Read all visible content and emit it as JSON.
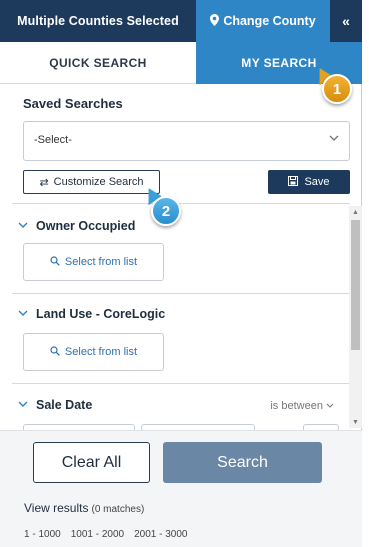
{
  "header": {
    "multiple_counties": "Multiple Counties Selected",
    "change_county": "Change County",
    "collapse": "«"
  },
  "tabs": [
    {
      "label": "QUICK SEARCH",
      "active": false
    },
    {
      "label": "MY SEARCH",
      "active": true
    }
  ],
  "callouts": [
    "1",
    "2"
  ],
  "saved": {
    "title": "Saved Searches",
    "select_value": "-Select-",
    "customize_label": "Customize Search",
    "save_label": "Save"
  },
  "filters": [
    {
      "title": "Owner Occupied",
      "button": "Select from list"
    },
    {
      "title": "Land Use - CoreLogic",
      "button": "Select from list"
    },
    {
      "title": "Sale Date",
      "operator": "is between"
    }
  ],
  "footer": {
    "clear_label": "Clear All",
    "search_label": "Search",
    "view_results": "View results",
    "matches": "(0 matches)",
    "ranges": [
      "1 - 1000",
      "1001 - 2000",
      "2001 - 3000"
    ]
  },
  "colors": {
    "navy": "#1d3a5c",
    "accent_blue": "#2f86c6",
    "search_button": "#6a88a6",
    "callout_orange": "#e0a020"
  }
}
